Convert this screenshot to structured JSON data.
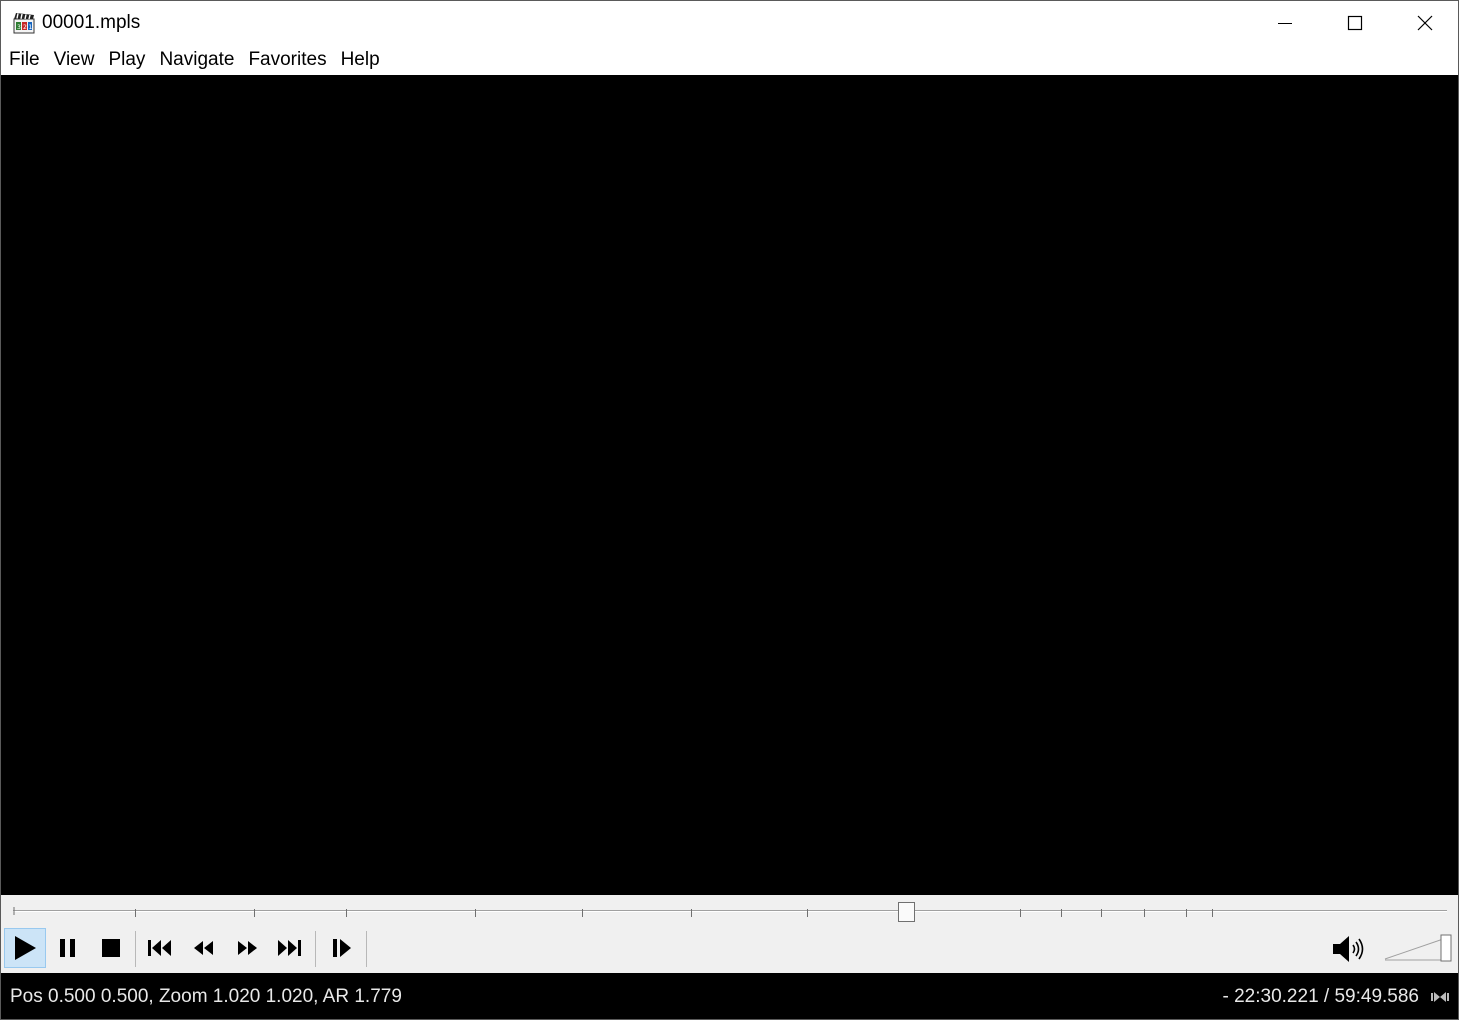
{
  "window": {
    "title": "00001.mpls",
    "icon": "mpc-hc-clapper-icon"
  },
  "menu": {
    "items": [
      {
        "label": "File"
      },
      {
        "label": "View"
      },
      {
        "label": "Play"
      },
      {
        "label": "Navigate"
      },
      {
        "label": "Favorites"
      },
      {
        "label": "Help"
      }
    ]
  },
  "seek": {
    "position_fraction": 0.623,
    "chapter_fractions": [
      0.085,
      0.168,
      0.232,
      0.322,
      0.397,
      0.473,
      0.554,
      0.627,
      0.702,
      0.731,
      0.759,
      0.789,
      0.818,
      0.836
    ]
  },
  "toolbar": {
    "buttons": [
      "play-icon",
      "pause-icon",
      "stop-icon",
      "skip-back-icon",
      "rewind-icon",
      "fast-forward-icon",
      "skip-forward-icon",
      "frame-step-icon"
    ],
    "volume_fraction": 1.0
  },
  "status": {
    "info": "Pos 0.500 0.500, Zoom 1.020 1.020, AR 1.779",
    "time": "- 22:30.221 / 59:49.586"
  },
  "colors": {
    "video_bg": "#000000",
    "toolbar_bg": "#f0f0f0",
    "active_button": "#cce4f7",
    "status_text": "#e8e8e8"
  }
}
